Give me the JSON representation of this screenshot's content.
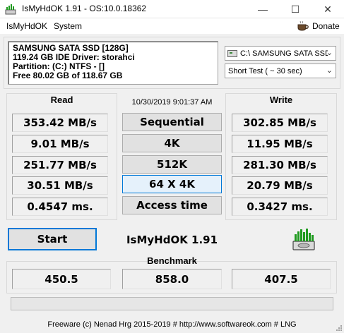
{
  "window": {
    "title": "IsMyHdOK 1.91 - OS:10.0.18362",
    "minimize": "—",
    "maximize": "☐",
    "close": "✕"
  },
  "menu": {
    "items": [
      "IsMyHdOK",
      "System"
    ],
    "donate": "Donate"
  },
  "drive_info": {
    "lines": [
      "SAMSUNG SATA SSD [128G]",
      "119.24 GB  IDE Driver: storahci",
      "Partition: (C:) NTFS - []",
      "Free 80.02 GB of 118.67 GB"
    ]
  },
  "drive_select": {
    "value": "C:\\ SAMSUNG SATA SSD"
  },
  "test_select": {
    "value": "Short Test ( ~ 30 sec)"
  },
  "columns": {
    "read": "Read",
    "write": "Write"
  },
  "datetime": "10/30/2019 9:01:37 AM",
  "tests": [
    {
      "label": "Sequential",
      "read": "353.42 MB/s",
      "write": "302.85 MB/s"
    },
    {
      "label": "4K",
      "read": "9.01 MB/s",
      "write": "11.95 MB/s"
    },
    {
      "label": "512K",
      "read": "251.77 MB/s",
      "write": "281.30 MB/s"
    },
    {
      "label": "64 X 4K",
      "read": "30.51 MB/s",
      "write": "20.79 MB/s"
    },
    {
      "label": "Access time",
      "read": "0.4547 ms.",
      "write": "0.3427 ms."
    }
  ],
  "start_label": "Start",
  "app_name": "IsMyHdOK 1.91",
  "benchmark": {
    "label": "Benchmark",
    "read": "450.5",
    "total": "858.0",
    "write": "407.5"
  },
  "progress": {
    "fraction": 0
  },
  "footer": "Freeware (c) Nenad Hrg 2015-2019 # http://www.softwareok.com      # LNG",
  "colors": {
    "accent": "#0078d7",
    "logo_green": "#1f9a1f",
    "progress_green": "#06b025"
  },
  "icons": {
    "app": "hdd-graph-icon",
    "donate": "coffee-cup-icon",
    "drive": "drive-icon",
    "dropdown": "chevron-down-icon"
  }
}
